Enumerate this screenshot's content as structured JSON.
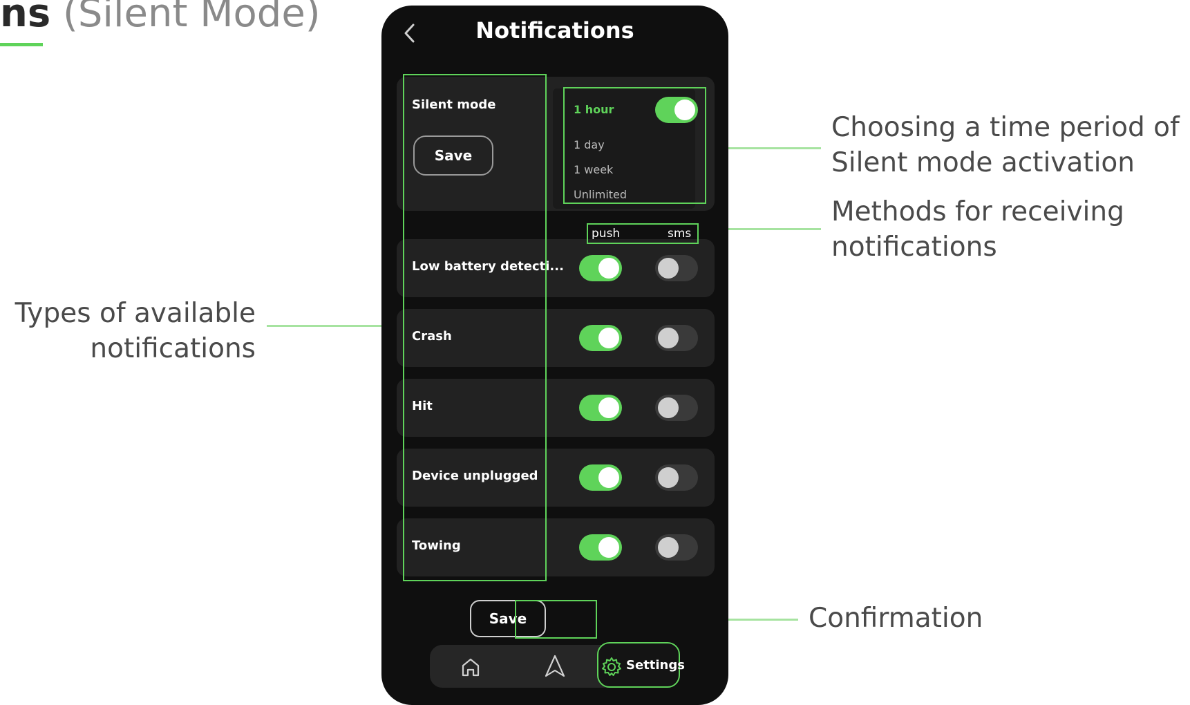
{
  "page": {
    "heading_bold": "ns",
    "heading_light": " (Silent Mode)"
  },
  "annotations": {
    "types": [
      "Types of available",
      "notifications"
    ],
    "period": [
      "Choosing a time period of",
      "Silent mode activation"
    ],
    "methods": [
      "Methods for receiving",
      "notifications"
    ],
    "confirmation": "Confirmation"
  },
  "screen": {
    "title": "Notifications",
    "silent_mode": {
      "label": "Silent mode",
      "save_label": "Save",
      "options": [
        "1 hour",
        "1 day",
        "1 week",
        "Unlimited"
      ],
      "selected": "1 hour",
      "enabled": true
    },
    "columns": {
      "push": "push",
      "sms": "sms"
    },
    "notifications": [
      {
        "label": "Low battery detecti...",
        "push": true,
        "sms": false
      },
      {
        "label": "Crash",
        "push": true,
        "sms": false
      },
      {
        "label": "Hit",
        "push": true,
        "sms": false
      },
      {
        "label": "Device unplugged",
        "push": true,
        "sms": false
      },
      {
        "label": "Towing",
        "push": true,
        "sms": false
      }
    ],
    "save_button": "Save",
    "nav": {
      "settings_label": "Settings",
      "active": "settings"
    }
  },
  "colors": {
    "accent": "#5fd35a",
    "background": "#0f0f0f",
    "card": "#222222",
    "annotation_line": "#a6e3a0"
  },
  "icons": [
    "chevron-left-icon",
    "home-icon",
    "navigation-arrow-icon",
    "gear-icon"
  ]
}
